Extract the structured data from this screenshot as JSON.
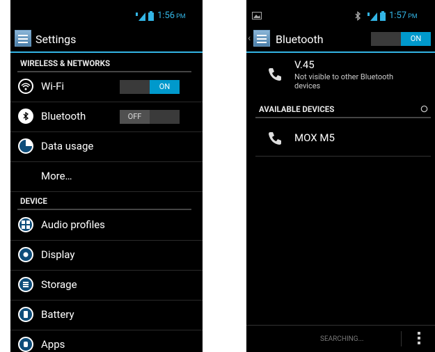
{
  "settings_screen": {
    "status": {
      "time": "1:56",
      "ampm": "PM"
    },
    "title": "Settings",
    "sections": [
      {
        "header": "WIRELESS & NETWORKS"
      },
      {
        "header": "DEVICE"
      }
    ],
    "items": {
      "wifi": {
        "label": "Wi-Fi",
        "toggle": "ON"
      },
      "bluetooth": {
        "label": "Bluetooth",
        "toggle": "OFF"
      },
      "data_usage": {
        "label": "Data usage"
      },
      "more": {
        "label": "More…"
      },
      "audio_profiles": {
        "label": "Audio profiles"
      },
      "display": {
        "label": "Display"
      },
      "storage": {
        "label": "Storage"
      },
      "battery": {
        "label": "Battery"
      },
      "apps": {
        "label": "Apps"
      }
    }
  },
  "bluetooth_screen": {
    "status": {
      "time": "1:57",
      "ampm": "PM"
    },
    "title": "Bluetooth",
    "toggle": "ON",
    "device": {
      "name": "V.45",
      "subtitle": "Not visible to other Bluetooth devices"
    },
    "available_header": "AVAILABLE DEVICES",
    "available": [
      {
        "name": "MOX M5"
      }
    ],
    "bottom": {
      "searching": "SEARCHING..."
    }
  },
  "colors": {
    "accent": "#33b5e5",
    "toggle_on": "#0099cc",
    "background": "#000000"
  },
  "icons": [
    "wifi-icon",
    "bluetooth-icon",
    "data-usage-icon",
    "audio-profiles-icon",
    "display-icon",
    "storage-icon",
    "battery-icon",
    "apps-icon",
    "phone-icon",
    "overflow-menu-icon",
    "spinner-icon"
  ]
}
